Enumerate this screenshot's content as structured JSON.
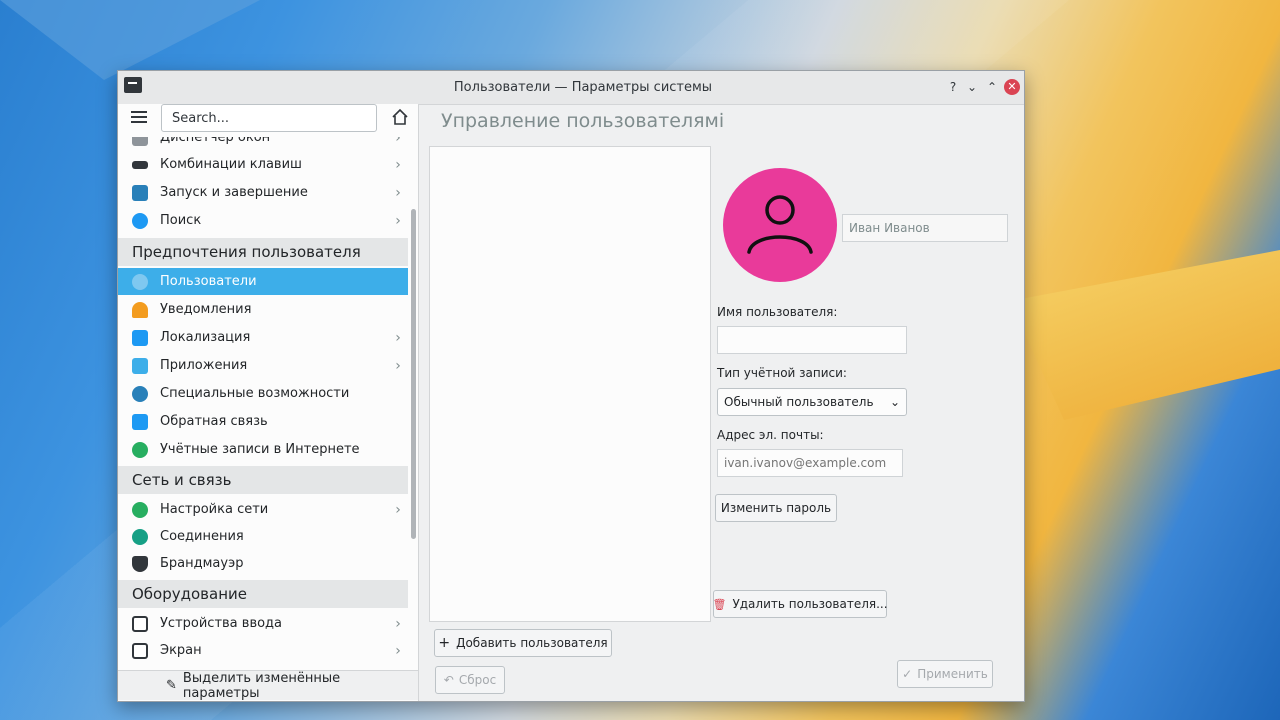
{
  "window": {
    "title": "Пользователи — Параметры системы",
    "help_label": "?",
    "minimize_label": "⌄",
    "maximize_label": "⌃",
    "close_label": "✕"
  },
  "sidebar": {
    "search_value": "Search...",
    "items": [
      {
        "label": "Диспетчер окон",
        "chevron": "›",
        "color": "#8e949a"
      },
      {
        "label": "Комбинации клавиш",
        "chevron": "›",
        "color": "#31363b"
      },
      {
        "label": "Запуск и завершение",
        "chevron": "›",
        "color": "#2980b9"
      },
      {
        "label": "Поиск",
        "chevron": "›",
        "color": "#1d99f3"
      },
      {
        "label": "Пользователи",
        "chevron": "",
        "color": "#3daee9"
      },
      {
        "label": "Уведомления",
        "chevron": "",
        "color": "#f39c1f"
      },
      {
        "label": "Локализация",
        "chevron": "›",
        "color": "#1d99f3"
      },
      {
        "label": "Приложения",
        "chevron": "›",
        "color": "#3daee9"
      },
      {
        "label": "Специальные возможности",
        "chevron": "",
        "color": "#2980b9"
      },
      {
        "label": "Обратная связь",
        "chevron": "",
        "color": "#1d99f3"
      },
      {
        "label": "Учётные записи в Интернете",
        "chevron": "",
        "color": "#27ae60"
      },
      {
        "label": "Настройка сети",
        "chevron": "›",
        "color": "#27ae60"
      },
      {
        "label": "Соединения",
        "chevron": "",
        "color": "#16a085"
      },
      {
        "label": "Брандмауэр",
        "chevron": "",
        "color": "#31363b"
      },
      {
        "label": "Устройства ввода",
        "chevron": "›",
        "color": "#31363b"
      },
      {
        "label": "Экран",
        "chevron": "›",
        "color": "#31363b"
      }
    ],
    "sections": [
      "Предпочтения пользователя",
      "Сеть и связь",
      "Оборудование"
    ],
    "highlight_label": "Выделить изменённые параметры"
  },
  "main": {
    "title": "Управление пользователямі",
    "full_name": "Иван Иванов",
    "username_label": "Имя пользователя:",
    "username_value": "",
    "account_type_label": "Тип учётной записи:",
    "account_type_value": "Обычный пользователь",
    "email_label": "Адрес эл. почты:",
    "email_placeholder": "ivan.ivanov@example.com",
    "change_password_label": "Изменить пароль",
    "delete_user_label": "Удалить пользователя...",
    "add_user_label": "Добавить пользователя",
    "reset_label": "Сброс",
    "apply_label": "Применить"
  },
  "colors": {
    "avatar": "#e93a9a",
    "selection": "#3daee9"
  }
}
